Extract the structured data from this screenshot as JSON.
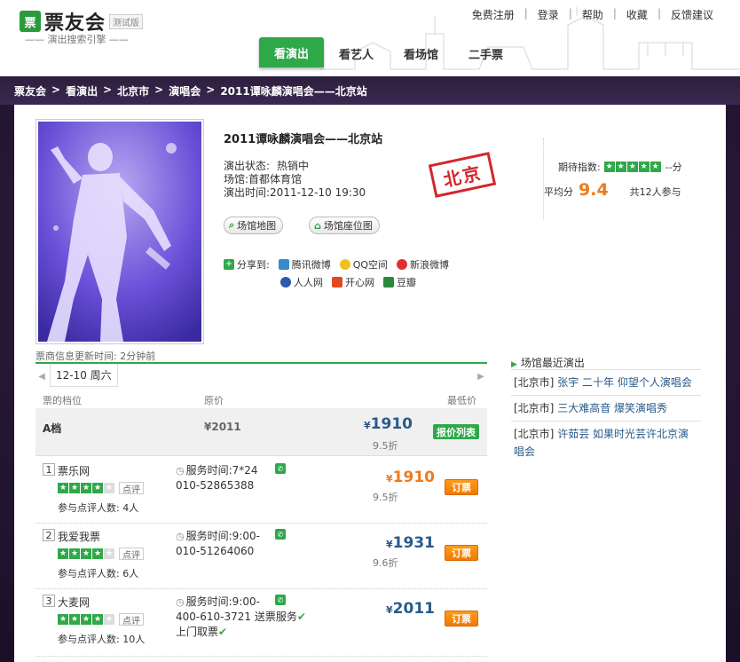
{
  "header": {
    "logo_text": "票友会",
    "logo_mark": "票",
    "beta": "测试版",
    "slogan": "—— 演出搜索引擎 ——",
    "top_links": [
      "免费注册",
      "登录",
      "帮助",
      "收藏",
      "反馈建议"
    ],
    "nav": [
      {
        "label": "看演出",
        "active": true
      },
      {
        "label": "看艺人",
        "active": false
      },
      {
        "label": "看场馆",
        "active": false
      },
      {
        "label": "二手票",
        "active": false
      }
    ]
  },
  "breadcrumb": [
    "票友会",
    "看演出",
    "北京市",
    "演唱会",
    "2011谭咏麟演唱会——北京站"
  ],
  "event": {
    "title": "2011谭咏麟演唱会——北京站",
    "status_label": "演出状态:",
    "status_value": "热销中",
    "venue_label": "场馆:",
    "venue_value": "首都体育馆",
    "time_label": "演出时间:",
    "time_value": "2011-12-10 19:30",
    "stamp": "北京",
    "map_button": "场馆地图",
    "seat_button": "场馆座位图",
    "share_label": "分享到:",
    "share_row1": [
      "腾讯微博",
      "QQ空间",
      "新浪微博"
    ],
    "share_row2": [
      "人人网",
      "开心网",
      "豆瓣"
    ]
  },
  "rating": {
    "expect_label": "期待指数:",
    "expect_value": "--分",
    "avg_label": "平均分",
    "avg_score": "9.4",
    "participants": "共12人参与",
    "stars_on": 5
  },
  "tickets": {
    "updated": "票商信息更新时间: 2分钟前",
    "date_tab": "12-10 周六",
    "col_grade": "票的档位",
    "col_price": "原价",
    "col_min": "最低价",
    "grade": {
      "name": "A档",
      "orig": "¥2011",
      "min_yen": "¥",
      "min": "1910",
      "discount": "9.5折",
      "list_button": "报价列表"
    },
    "vendors": [
      {
        "num": "1",
        "name": "票乐网",
        "stars_on": 4,
        "comment": "点评",
        "count": "参与点评人数: 4人",
        "svc1": "服务时间:7*24",
        "svc2": "010-52865388",
        "svc3": "",
        "yen": "¥",
        "price": "1910",
        "discount": "9.5折",
        "price_color": "orange",
        "order": "订票"
      },
      {
        "num": "2",
        "name": "我爱我票",
        "stars_on": 4,
        "comment": "点评",
        "count": "参与点评人数: 6人",
        "svc1": "服务时间:9:00-",
        "svc2": "010-51264060",
        "svc3": "",
        "yen": "¥",
        "price": "1931",
        "discount": "9.6折",
        "price_color": "blue",
        "order": "订票"
      },
      {
        "num": "3",
        "name": "大麦网",
        "stars_on": 4,
        "comment": "点评",
        "count": "参与点评人数: 10人",
        "svc1": "服务时间:9:00-",
        "svc2": "400-610-3721",
        "svc3": "上门取票",
        "extra": "送票服务",
        "yen": "¥",
        "price": "2011",
        "discount": "",
        "price_color": "blue",
        "order": "订票"
      }
    ]
  },
  "sidebar": {
    "title": "场馆最近演出",
    "items": [
      {
        "tag": "[北京市]",
        "text": "张宇 二十年 仰望个人演唱会"
      },
      {
        "tag": "[北京市]",
        "text": "三大难高音 爆笑演唱秀"
      },
      {
        "tag": "[北京市]",
        "text": "许茹芸 如果时光芸许北京演唱会"
      }
    ]
  }
}
